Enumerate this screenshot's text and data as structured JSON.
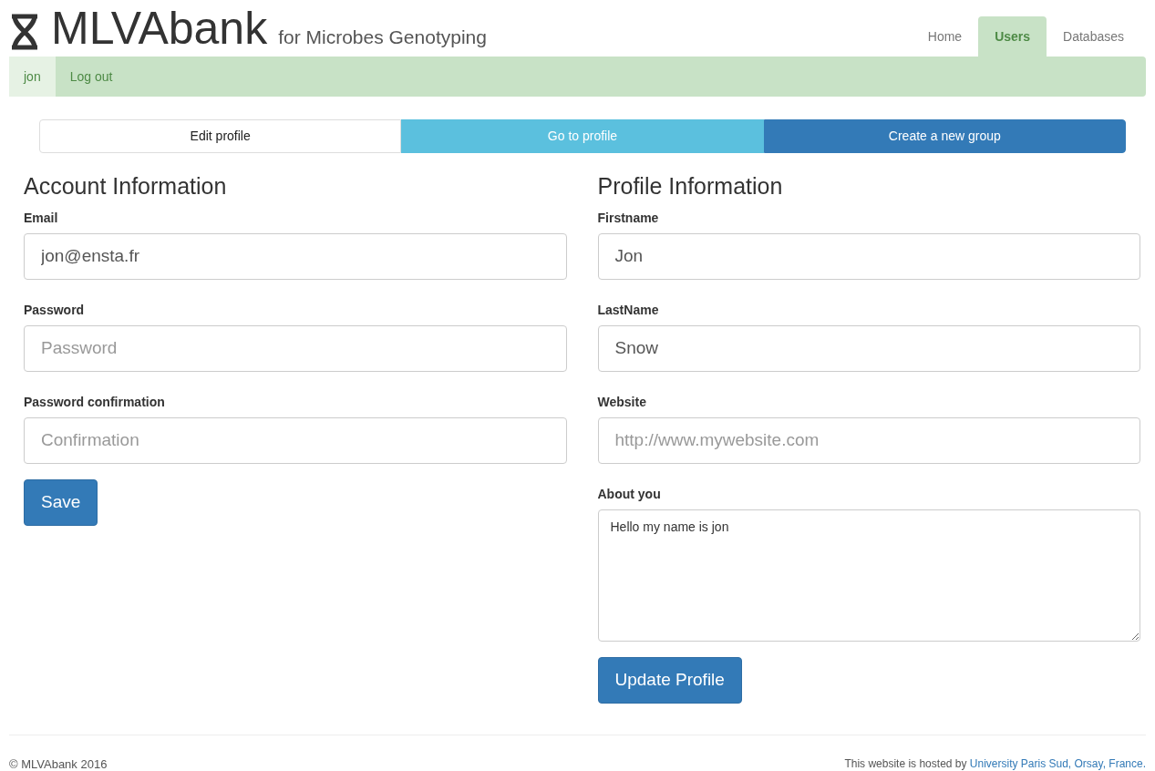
{
  "brand": {
    "title": "MLVAbank",
    "tagline": "for Microbes Genotyping"
  },
  "nav_tabs": [
    {
      "label": "Home",
      "selected": false
    },
    {
      "label": "Users",
      "selected": true
    },
    {
      "label": "Databases",
      "selected": false
    }
  ],
  "subnav": [
    {
      "label": "jon",
      "selected": true
    },
    {
      "label": "Log out",
      "selected": false
    }
  ],
  "action_buttons": [
    {
      "label": "Edit profile",
      "kind": "default"
    },
    {
      "label": "Go to profile",
      "kind": "info"
    },
    {
      "label": "Create a new group",
      "kind": "primary"
    }
  ],
  "account": {
    "heading": "Account Information",
    "fields": [
      {
        "label": "Email",
        "value": "jon@ensta.fr"
      },
      {
        "label": "Password",
        "placeholder": "Password"
      },
      {
        "label": "Password confirmation",
        "placeholder": "Confirmation"
      }
    ],
    "button": "Save"
  },
  "profile": {
    "heading": "Profile Information",
    "fields": [
      {
        "label": "Firstname",
        "value": "Jon"
      },
      {
        "label": "LastName",
        "value": "Snow"
      },
      {
        "label": "Website",
        "placeholder": "http://www.mywebsite.com"
      }
    ],
    "about": {
      "label": "About you",
      "value": "Hello my name is jon"
    },
    "button": "Update Profile"
  },
  "footer": {
    "copyright": "© MLVAbank 2016",
    "hosted_text": "This website is hosted by",
    "hosted_link": "University Paris Sud, Orsay, France."
  }
}
